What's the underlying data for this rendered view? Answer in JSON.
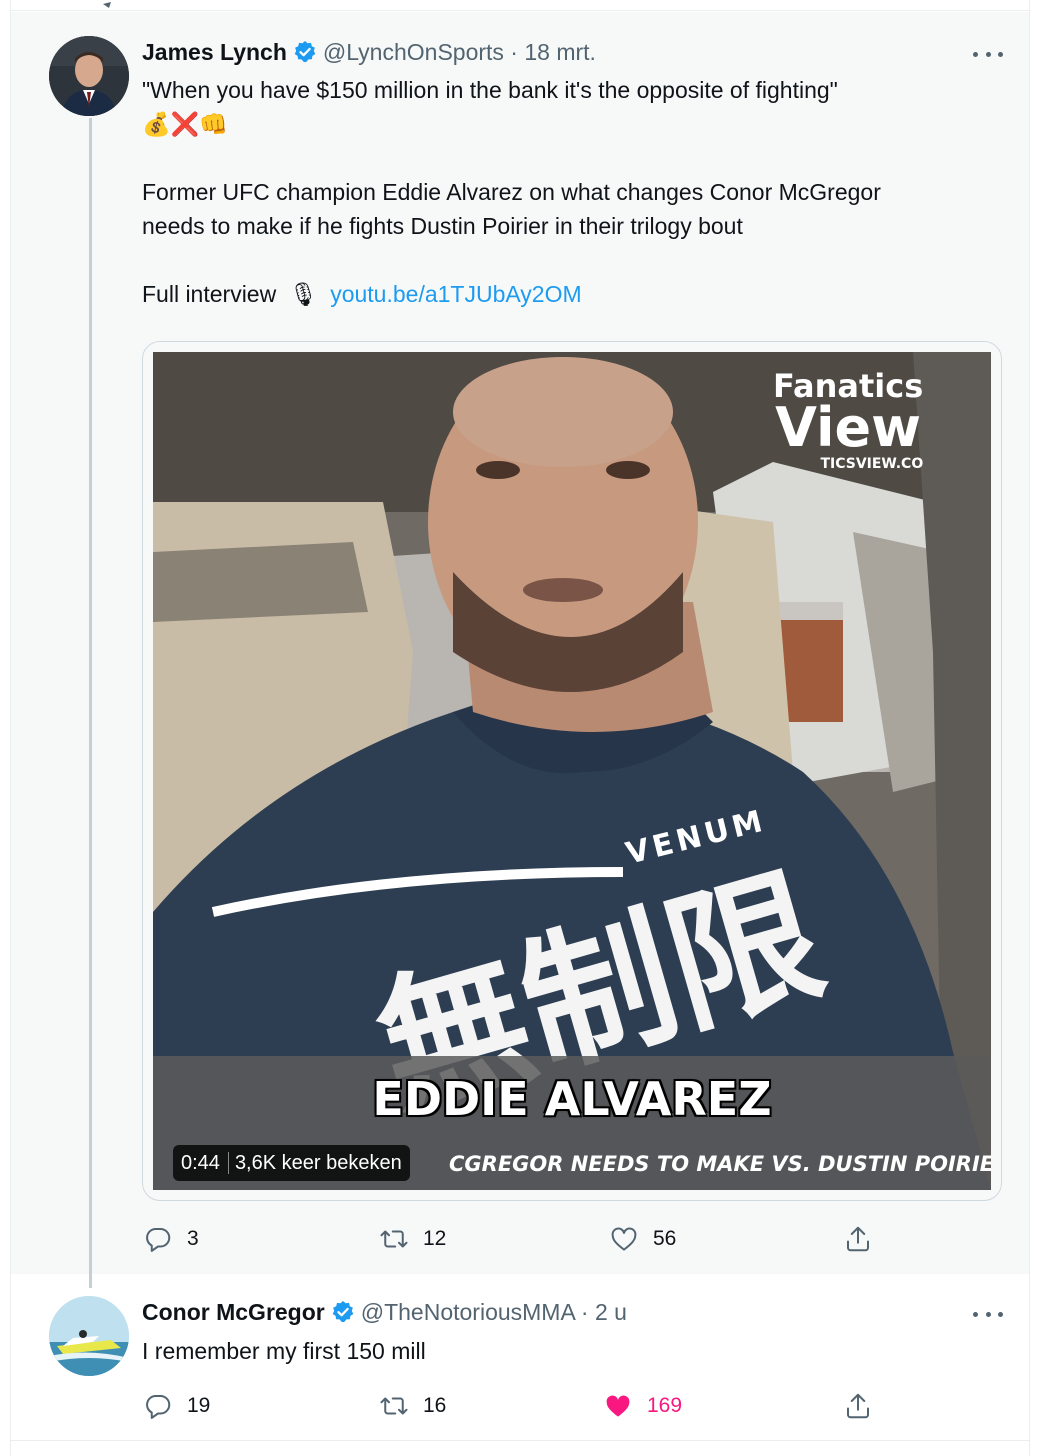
{
  "tweets": [
    {
      "name": "James Lynch",
      "handle": "@LynchOnSports · 18 mrt.",
      "text_line1": "\"When you have $150 million in the bank it's the opposite of fighting\"",
      "emoji_line": "💰❌👊",
      "text_para2_line1": "Former UFC champion Eddie Alvarez on what changes Conor McGregor",
      "text_para2_line2": "needs to make if he fights Dustin Poirier in their trilogy bout",
      "full_interview_label": "Full interview",
      "mic_emoji": "🎙",
      "link": "youtu.be/a1TJUbAy2OM",
      "video": {
        "logo_line1": "Fanatics",
        "logo_line2": "View",
        "logo_line3": "TICSVIEW.CO",
        "shirt_brand": "VENUM",
        "shirt_text": "無制限",
        "caption_name": "EDDIE ALVAREZ",
        "caption_sub": "CGREGOR NEEDS TO MAKE VS. DUSTIN POIRIER",
        "duration": "0:44",
        "views": "3,6K keer bekeken"
      },
      "replies": "3",
      "retweets": "12",
      "likes": "56"
    },
    {
      "name": "Conor McGregor",
      "handle": "@TheNotoriousMMA · 2 u",
      "text": "I remember my first 150 mill",
      "replies": "19",
      "retweets": "16",
      "likes": "169"
    }
  ],
  "colors": {
    "verified": "#1d9bf0",
    "link": "#1d9bf0",
    "like_active": "#f91880",
    "muted": "#536471"
  }
}
